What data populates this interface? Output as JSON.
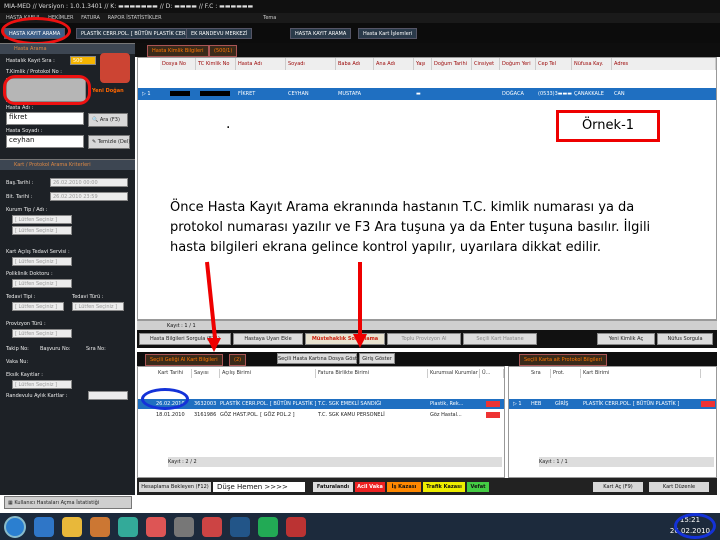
{
  "titlebar": {
    "text": "MIA-MED // Versiyon : 1.0.1.3401 // K: ▬▬▬▬▬▬▬ // D: ▬▬▬▬ // F.C : ▬▬▬▬▬▬"
  },
  "menubar": {
    "items": [
      "HASTA KABUL",
      "HEKİMLER",
      "FATURA",
      "RAPOR İSTATİSTİKLER",
      "Tema"
    ]
  },
  "tabs": [
    "HASTA KAYIT ARAMA",
    "PLASTİK CERR.POL. [ BÜTÜN PLASTİK CERR.POL. ]",
    "EK RANDEVU MERKEZİ",
    "HASTA KAYIT ARAMA",
    "Hasta Kart İşlemleri"
  ],
  "left": {
    "section1": "Hasta Arama",
    "kayit_label": "Hastalık Kayıt Sıra :",
    "kayit_value": "500",
    "tc_label": "T.Kimlik / Protokol No :",
    "yeni_dogan": "Yeni Doğan",
    "ad_label": "Hasta Adı :",
    "ad_value": "fikret",
    "ara_button": "Ara (F3)",
    "soyad_label": "Hasta Soyadı :",
    "soyad_value": "ceyhan",
    "temizle_button": "Temizle (Del)",
    "section2": "Kart / Protokol Arama Kriterleri",
    "bas_tarih_label": "Baş.Tarihi :",
    "bas_tarih_value": "26.02.2010 00:00",
    "bit_tarih_label": "Bit. Tarihi :",
    "bit_tarih_value": "26.02.2010 23:59",
    "kurum_label": "Kurum Tip / Adı :",
    "sec_placeholder": "[ Lütfen Seçiniz ]",
    "kart_acilis_label": "Kart Açılış Tedavi Servisi :",
    "poliklinik_label": "Poliklinik Doktoru :",
    "tedavi_tipi_label": "Tedavi Tipi :",
    "tedavi_turu_label": "Tedavi Türü :",
    "provizyon_label": "Provizyon Türü :",
    "takip_label": "Takip No:",
    "basvuru_label": "Başvuru No:",
    "sira_label": "Sıra No:",
    "vaka_label": "Vaka Nu:",
    "eksik_label": "Eksik Kayıtlar :",
    "randevulu_label": "Randevulu Aylık Kartlar :",
    "istatistik_button": "Kullanıcı Hastaları Açma İstatistiği"
  },
  "header_strip": {
    "tab1": "Hasta Kimlik Bilgileri",
    "tab2": "(500/1)"
  },
  "grid": {
    "columns": [
      "Dosya No",
      "TC Kimlik No",
      "Hasta Adı",
      "Soyadı",
      "Baba Adı",
      "Ana Adı",
      "Yaşı",
      "Doğum Tarihi",
      "Cinsiyet",
      "Doğum Yeri",
      "Cep Tel",
      "Nüfusa Kay.",
      "Adres"
    ],
    "row": {
      "marker": "▷ 1",
      "ad": "FİKRET",
      "soyad": "CEYHAN",
      "baba": "MUSTAFA",
      "yas": "▬",
      "dogum_yeri": "DOĞACA",
      "cep": "(0533)3▬▬▬",
      "nufus": "ÇANAKKALE",
      "adres": "CAN"
    }
  },
  "annotation": {
    "dot": ".",
    "ornek": "Örnek-1",
    "caption": "Önce Hasta Kayıt Arama ekranında hastanın T.C. kimlik numarası ya da protokol numarası yazılır ve F3 Ara tuşuna ya da Enter tuşuna basılır. İlgili hasta bilgileri ekrana gelince kontrol yapılır, uyarılara dikkat edilir."
  },
  "grid_footer": {
    "text": "Kayıt : 1 / 1"
  },
  "action_buttons": [
    "Hasta Bilgileri Sorgula (F11)",
    "Hastaya Uyarı Ekle",
    "Müstehaklık Sorgulama",
    "Toplu Provizyon Al",
    "Seçili Kart Hastane",
    "Yeni Kimlik Aç",
    "Nüfus Sorgula"
  ],
  "bottom_tabs": {
    "left": "Seçili Geliği Al Kart Bilgileri",
    "left_count": "(2)",
    "mid1": "Seçili Hasta Kartına Dosya Göster",
    "mid2": "Giriş Göster",
    "right": "Seçili Karta ait Protokol Bilgileri"
  },
  "bottom_left": {
    "columns": [
      "Kart Tarihi",
      "Sayısı",
      "Açılış Birimi",
      "Fatura Birlikte Birimi",
      "Kurumsal Kurumlar",
      "Ü..."
    ],
    "rows": [
      {
        "tarih": "26.02.2010",
        "no": "3632003",
        "birim": "PLASTİK CERR.POL. [ BÜTÜN PLASTİK ]",
        "kurum": "T.C. SGK EMEKLİ SANDIĞI",
        "tip": "Plastik, Rek..."
      },
      {
        "tarih": "18.01.2010",
        "no": "3161986",
        "birim": "GÖZ HAST.POL. [ GÖZ POL.2 ]",
        "kurum": "T.C. SGK KAMU PERSONELİ",
        "tip": "Göz Hastal..."
      }
    ],
    "footer": "Kayıt : 2 / 2"
  },
  "bottom_right": {
    "columns": [
      "Sıra",
      "Prot.",
      "Kart Birimi"
    ],
    "row": {
      "sira": "▷ 1",
      "prot": "HEB",
      "giris": "GİRİŞ",
      "birim": "PLASTİK CERR.POL. [ BÜTÜN PLASTİK ]"
    },
    "footer": "Kayıt : 1 / 1"
  },
  "bottom_buttons": {
    "left": "Kullanıcı Hastaları Açma İstatistiği",
    "mid": "Hesaplama Bekleyen (F12)",
    "input": "Düşe Hemen >>>>",
    "faturalandi": "Faturalandı",
    "acil": "Acil Vaka",
    "is_kazasi": "İş Kazası",
    "trafik": "Trafik Kazası",
    "vefat": "Vefat",
    "ac_kart": "Kart Aç (F9)",
    "kart_duzenle": "Kart Düzenle"
  },
  "taskbar": {
    "time": "15:21",
    "date": "26.02.2010"
  },
  "colors": {
    "red_highlight": "#e11",
    "blue_highlight": "#1432d8",
    "selection": "#1f6fc1"
  }
}
